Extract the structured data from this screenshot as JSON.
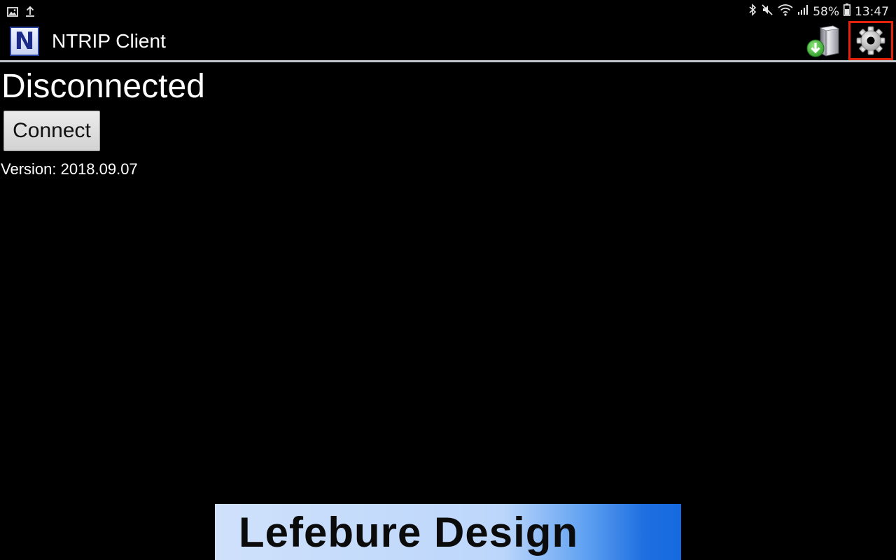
{
  "status_bar": {
    "left_icons": [
      "image-notification-icon",
      "upload-icon"
    ],
    "right_icons": [
      "bluetooth-icon",
      "mute-icon",
      "wifi-icon",
      "cell-signal-icon"
    ],
    "battery_percent": "58%",
    "time": "13:47"
  },
  "action_bar": {
    "logo_letter": "N",
    "title": "NTRIP Client",
    "actions": [
      "download-server-icon",
      "gear-icon"
    ],
    "highlight_color": "#e2220c"
  },
  "main": {
    "connection_status": "Disconnected",
    "connect_label": "Connect",
    "version": "Version: 2018.09.07"
  },
  "banner": {
    "text": "Lefebure Design"
  }
}
